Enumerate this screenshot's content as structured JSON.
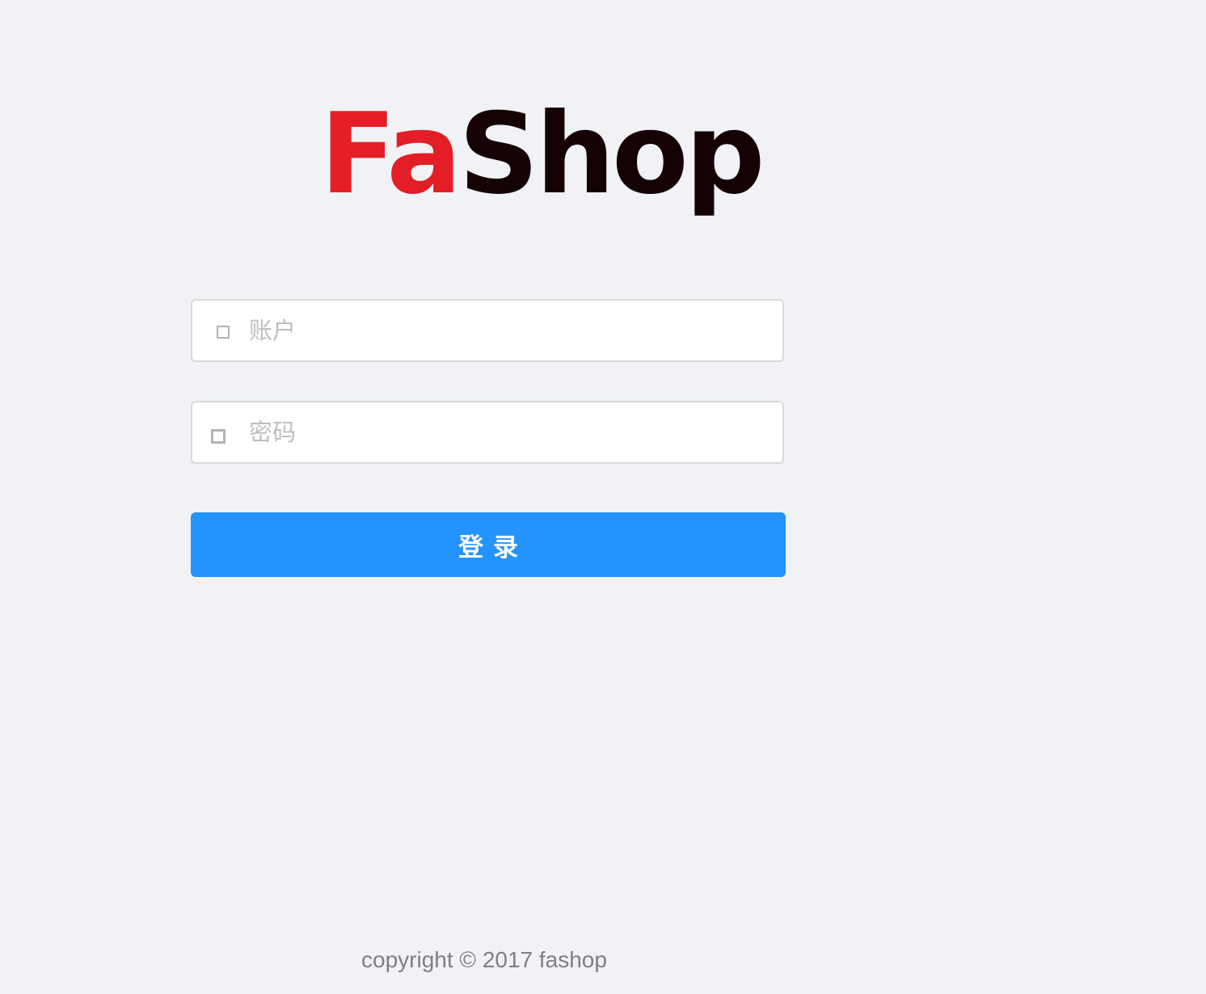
{
  "logo": {
    "part1": "Fa",
    "part2": "Shop",
    "colors": {
      "part1": "#e41e26",
      "part2": "#150205"
    }
  },
  "login_form": {
    "account": {
      "icon": "user-icon",
      "placeholder": "账户",
      "value": ""
    },
    "password": {
      "icon": "lock-icon",
      "placeholder": "密码",
      "value": ""
    },
    "submit_label": "登录"
  },
  "footer": {
    "copyright": "copyright © 2017 fashop"
  },
  "colors": {
    "background": "#f0f2f5",
    "primary": "#2593fc",
    "placeholder": "#bfbfbf",
    "footer_text": "#7f7f7f"
  }
}
